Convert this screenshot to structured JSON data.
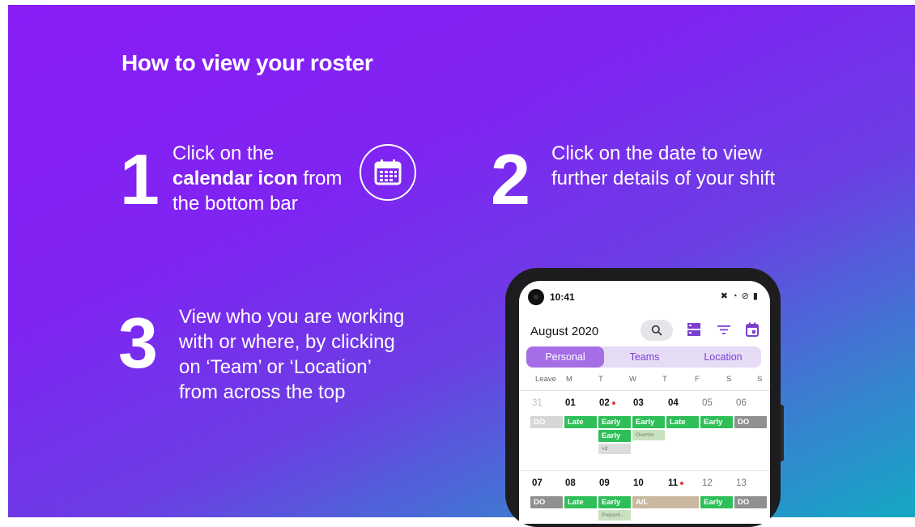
{
  "title": "How to view your roster",
  "steps": [
    {
      "number": "1",
      "line1": "Click on the",
      "line2_bold": "calendar icon",
      "line2_rest": " from",
      "line3": "the bottom bar"
    },
    {
      "number": "2",
      "line1": "Click on the date to view",
      "line2": "further details of your shift"
    },
    {
      "number": "3",
      "line1": "View who you are working",
      "line2": "with or where, by clicking",
      "line3": "on ‘Team’ or ‘Location’",
      "line4": "from across the top"
    }
  ],
  "phone": {
    "time": "10:41",
    "status_icons": "✖ ◔ ⊘ ▮",
    "month": "August 2020",
    "tabs": [
      "Personal",
      "Teams",
      "Location"
    ],
    "active_tab": "Personal",
    "weekdays": [
      "Leave",
      "M",
      "T",
      "W",
      "T",
      "F",
      "S",
      "S"
    ],
    "week1": {
      "dates": [
        "31",
        "01",
        "02",
        "03",
        "04",
        "05",
        "06"
      ],
      "shifts": [
        "DO",
        "Late",
        "Early",
        "Early",
        "Late",
        "Early",
        "DO"
      ],
      "extra": {
        "early2": "Early",
        "count": "+2",
        "note": "Overtim"
      }
    },
    "week2": {
      "dates": [
        "07",
        "08",
        "09",
        "10",
        "11",
        "12",
        "13"
      ],
      "shifts": [
        "DO",
        "Late",
        "Early",
        "A/L",
        "",
        "Early",
        "DO"
      ],
      "extra": {
        "note": "Prepont..."
      }
    },
    "colors": {
      "accent": "#a66ee6",
      "shift_green": "#2fbf58",
      "day_off_grey": "#909090"
    }
  }
}
